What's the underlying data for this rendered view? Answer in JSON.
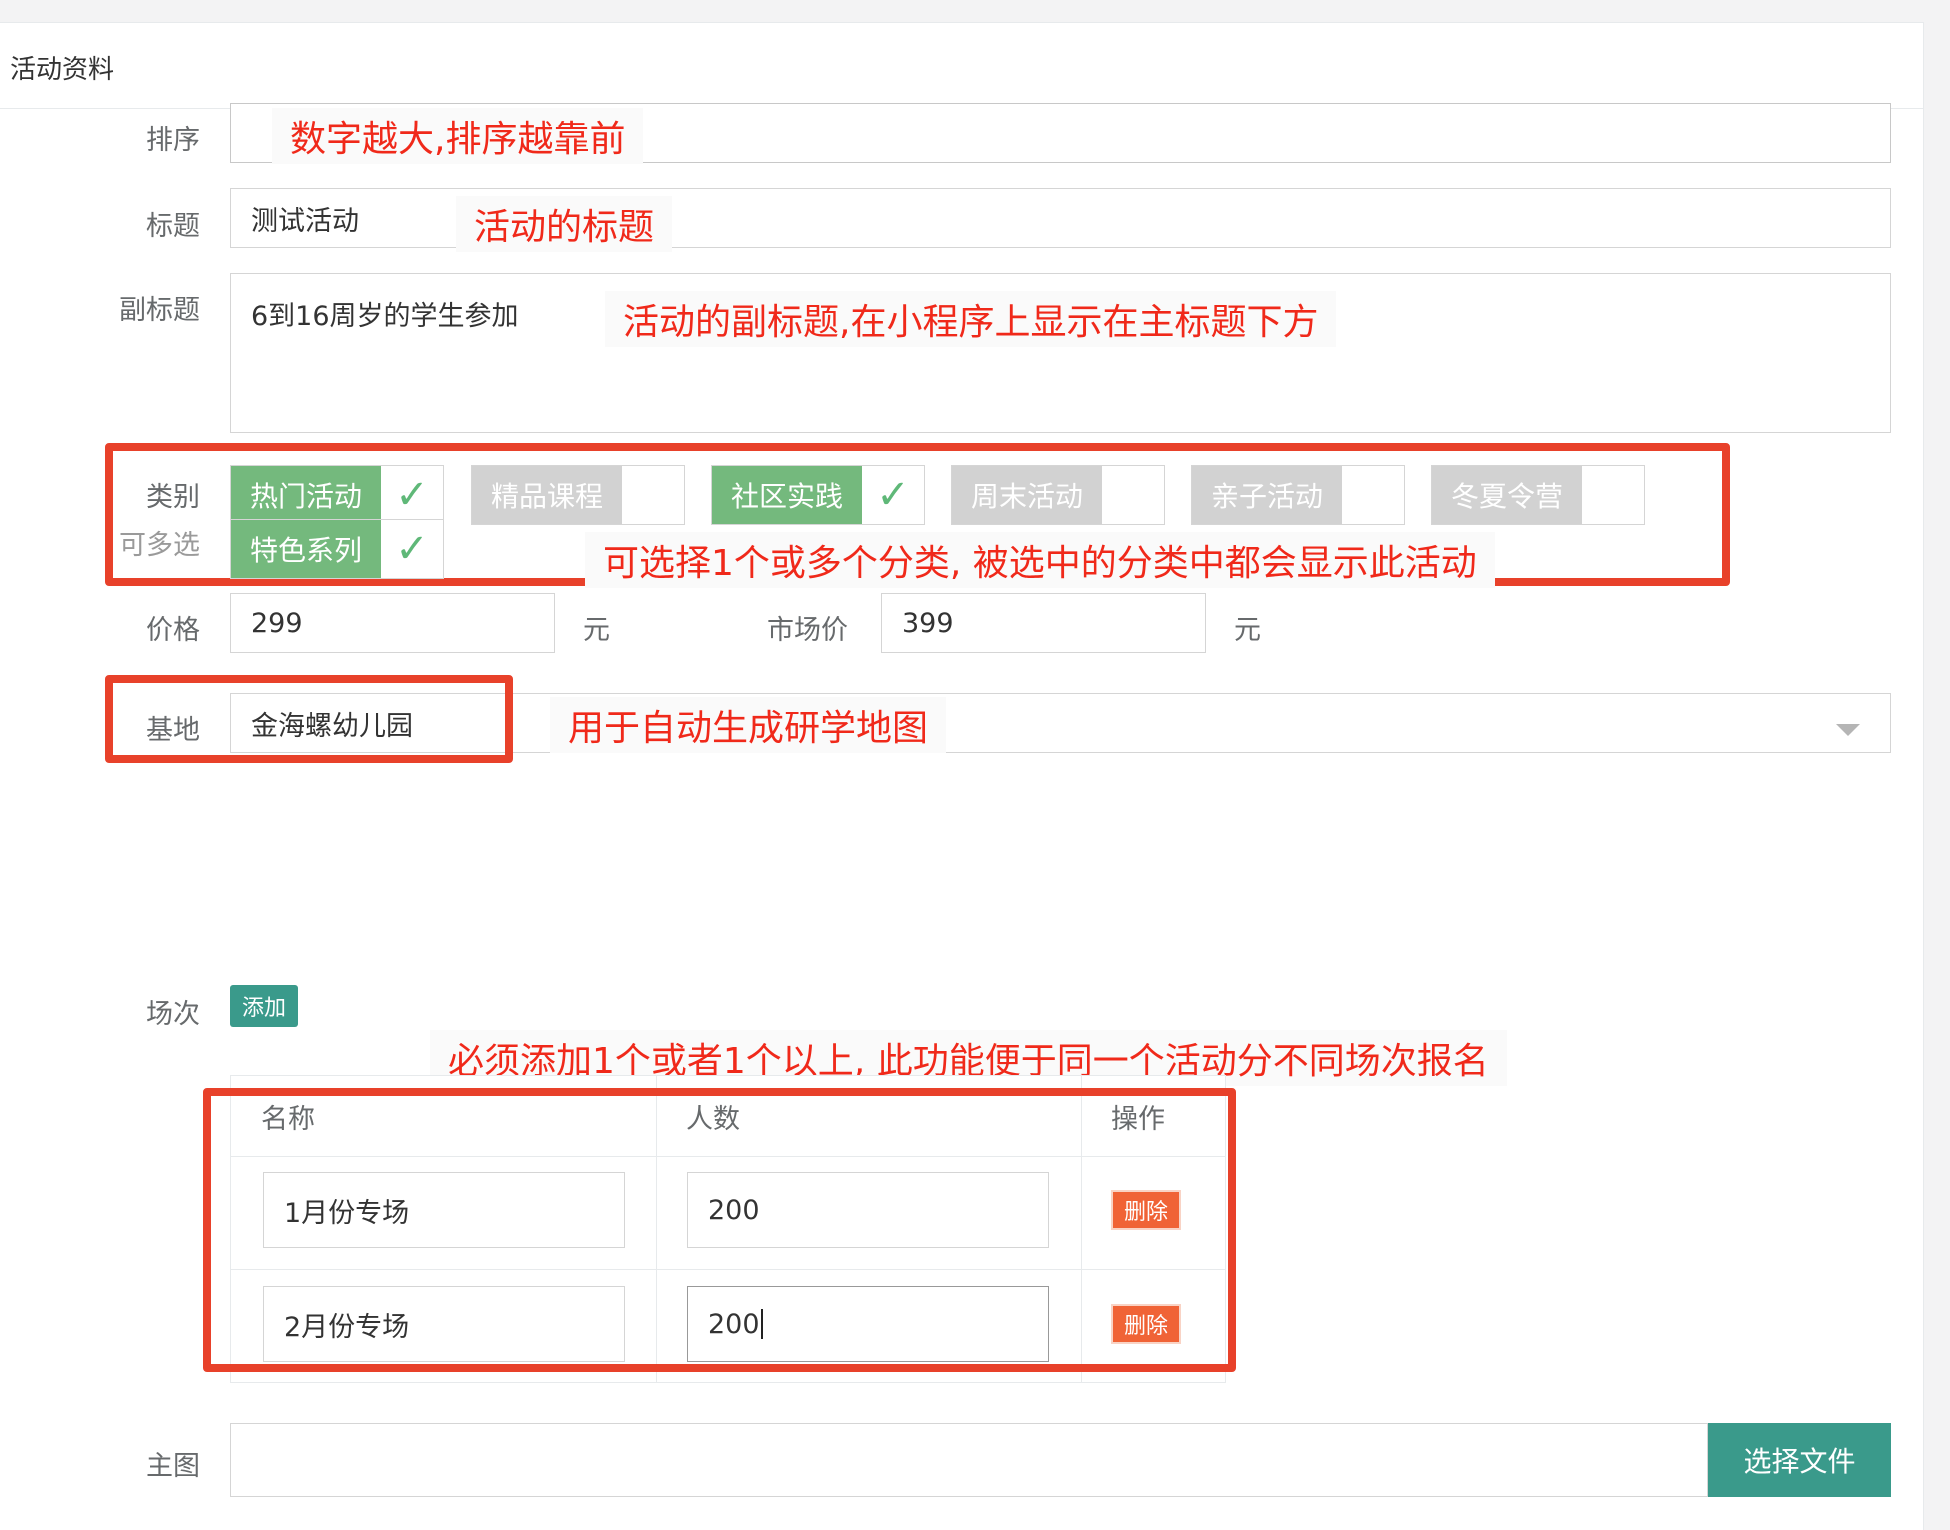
{
  "panel": {
    "title": "活动资料"
  },
  "form": {
    "sort": {
      "label": "排序",
      "value": "",
      "annotation": "数字越大,排序越靠前"
    },
    "title": {
      "label": "标题",
      "value": "测试活动",
      "annotation": "活动的标题"
    },
    "subtitle": {
      "label": "副标题",
      "value": "6到16周岁的学生参加",
      "annotation": "活动的副标题,在小程序上显示在主标题下方"
    },
    "category": {
      "label": "类别",
      "sublabel": "可多选",
      "annotation": "可选择1个或多个分类, 被选中的分类中都会显示此活动",
      "options": [
        {
          "label": "热门活动",
          "checked": true
        },
        {
          "label": "精品课程",
          "checked": false
        },
        {
          "label": "社区实践",
          "checked": true
        },
        {
          "label": "周末活动",
          "checked": false
        },
        {
          "label": "亲子活动",
          "checked": false
        },
        {
          "label": "冬夏令营",
          "checked": false
        },
        {
          "label": "特色系列",
          "checked": true
        }
      ],
      "check_icon": "checkmark-icon",
      "on_color": "#74b97d",
      "off_color": "#d2d2d2"
    },
    "price": {
      "label": "价格",
      "value": "299",
      "unit": "元",
      "market_label": "市场价",
      "market_value": "399",
      "market_unit": "元"
    },
    "base": {
      "label": "基地",
      "value": "金海螺幼儿园",
      "annotation": "用于自动生成研学地图"
    },
    "sessions": {
      "label": "场次",
      "add_label": "添加",
      "annotation": "必须添加1个或者1个以上, 此功能便于同一个活动分不同场次报名",
      "columns": [
        "名称",
        "人数",
        "操作"
      ],
      "rows": [
        {
          "name": "1月份专场",
          "count": "200",
          "delete_label": "删除"
        },
        {
          "name": "2月份专场",
          "count": "200",
          "delete_label": "删除"
        }
      ]
    },
    "main_image": {
      "label": "主图",
      "button_label": "选择文件"
    }
  },
  "colors": {
    "accent": "#3a9a8b",
    "annotation_red": "#f0291a",
    "highlight_box": "#e8412a",
    "delete_orange": "#f06336"
  }
}
